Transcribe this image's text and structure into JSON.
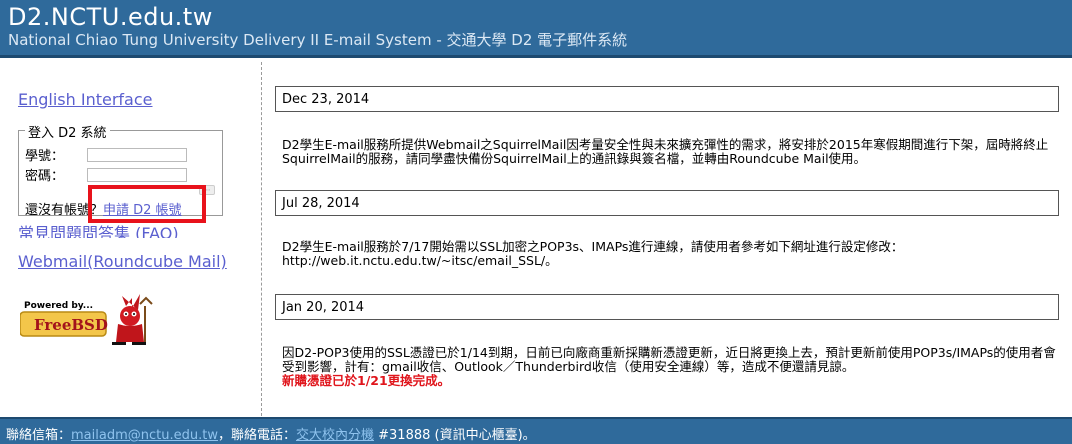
{
  "header": {
    "title": "D2.NCTU.edu.tw",
    "subtitle": "National Chiao Tung University Delivery II E-mail System - 交通大學 D2 電子郵件系統"
  },
  "sidebar": {
    "english_link": "English Interface",
    "login": {
      "legend": "登入 D2 系統",
      "id_label": "學號：",
      "id_value": "",
      "pw_label": "密碼：",
      "pw_value": "",
      "signup_prompt": "還沒有帳號？",
      "signup_link": "申請 D2 帳號"
    },
    "faq_link": "常見問題問答集 (FAQ)",
    "webmail_link": "Webmail(Roundcube Mail)",
    "freebsd": {
      "top_text": "Powered by...",
      "brand": "FreeBSD"
    }
  },
  "news": [
    {
      "date": "Dec 23, 2014",
      "text": "D2學生E-mail服務所提供Webmail之SquirrelMail因考量安全性與未來擴充彈性的需求，將安排於2015年寒假期間進行下架，屆時將終止SquirrelMail的服務，請同學盡快備份SquirrelMail上的通訊錄與簽名檔，並轉由Roundcube Mail使用。"
    },
    {
      "date": "Jul 28, 2014",
      "text": "D2學生E-mail服務於7/17開始需以SSL加密之POP3s、IMAPs進行連線，請使用者參考如下網址進行設定修改：",
      "url": "http://web.it.nctu.edu.tw/~itsc/email_SSL/。"
    },
    {
      "date": "Jan 20, 2014",
      "text": "因D2-POP3使用的SSL憑證已於1/14到期，日前已向廠商重新採購新憑證更新，近日將更換上去，預計更新前使用POP3s/IMAPs的使用者會受到影響，計有：gmail收信、Outlook／Thunderbird收信（使用安全連線）等，造成不便還請見諒。",
      "alert": "新購憑證已於1/21更換完成。"
    }
  ],
  "footer": {
    "mail_label": "聯絡信箱：",
    "mail_link": "mailadm@nctu.edu.tw",
    "phone_label": "，聯絡電話：",
    "phone_link": "交大校內分機",
    "phone_rest": " #31888 (資訊中心櫃臺)。"
  },
  "colors": {
    "header_bg": "#2f6a9b",
    "link": "#5a5fcf",
    "highlight": "#e8121b",
    "alert": "#e0151c"
  }
}
